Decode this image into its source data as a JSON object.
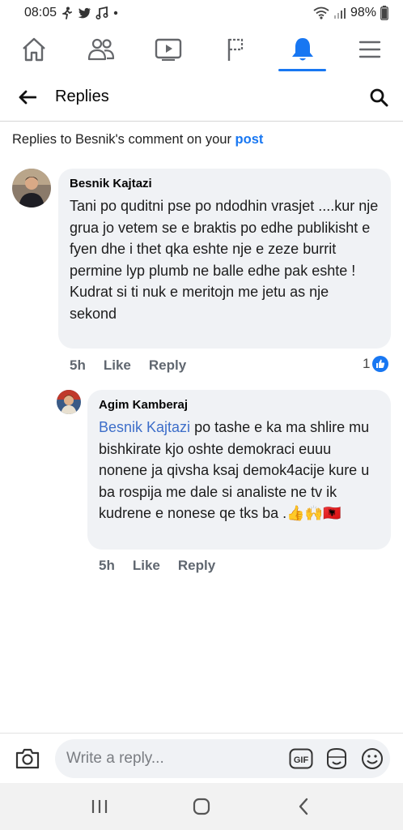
{
  "status_bar": {
    "time": "08:05",
    "battery": "98%"
  },
  "nav": {
    "items": [
      {
        "name": "home",
        "active": false
      },
      {
        "name": "friends",
        "active": false
      },
      {
        "name": "watch",
        "active": false
      },
      {
        "name": "pages",
        "active": false
      },
      {
        "name": "notifications",
        "active": true
      },
      {
        "name": "menu",
        "active": false
      }
    ],
    "accent": "#1877f2"
  },
  "header": {
    "title": "Replies"
  },
  "context": {
    "prefix": "Replies to Besnik's comment on your",
    "link": "post"
  },
  "comments": [
    {
      "author": "Besnik Kajtazi",
      "text": "Tani po quditni pse po ndodhin vrasjet ....kur nje grua jo vetem se e braktis po edhe publikisht e fyen dhe i thet qka eshte nje e zeze burrit permine lyp plumb ne balle edhe pak eshte ! Kudrat si ti nuk e meritojn me jetu as nje sekond",
      "time": "5h",
      "like_label": "Like",
      "reply_label": "Reply",
      "reaction_count": "1"
    },
    {
      "author": "Agim Kamberaj",
      "mention": "Besnik Kajtazi",
      "text": " po tashe e ka ma shlire mu bishkirate kjo oshte demokraci euuu nonene ja qivsha ksaj demok4acije kure u ba rospija me dale si analiste ne tv ik kudrene e nonese qe tks ba .",
      "emoji": "👍🙌🇦🇱",
      "time": "5h",
      "like_label": "Like",
      "reply_label": "Reply"
    }
  ],
  "composer": {
    "placeholder": "Write a reply...",
    "gif_label": "GIF"
  }
}
